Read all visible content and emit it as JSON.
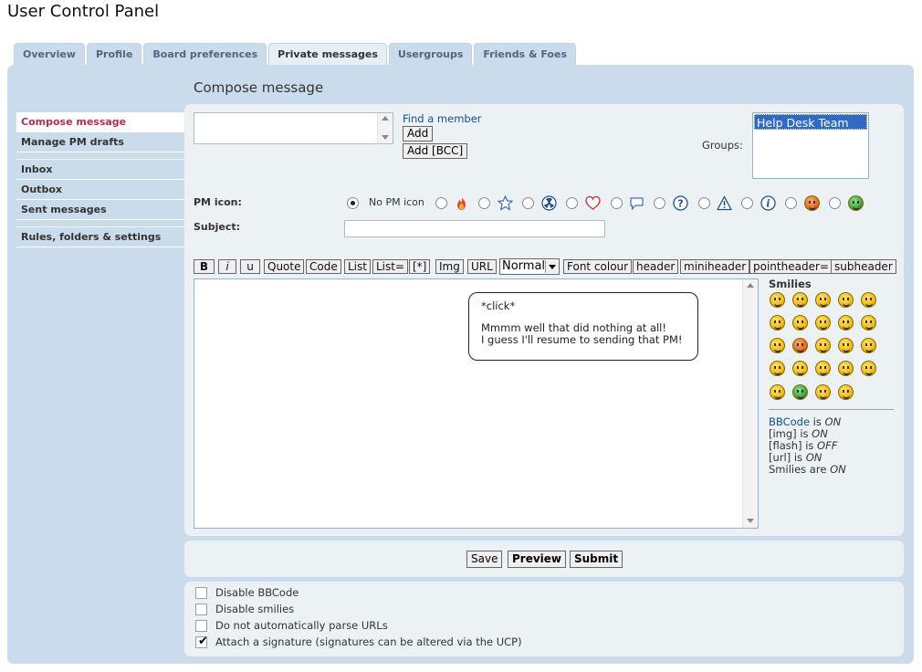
{
  "page": {
    "title": "User Control Panel"
  },
  "tabs": [
    "Overview",
    "Profile",
    "Board preferences",
    "Private messages",
    "Usergroups",
    "Friends & Foes"
  ],
  "compose": {
    "title": "Compose message"
  },
  "sidebar": {
    "group1": [
      "Compose message",
      "Manage PM drafts"
    ],
    "group2": [
      "Inbox",
      "Outbox",
      "Sent messages"
    ],
    "group3": [
      "Rules, folders & settings"
    ]
  },
  "recipients": {
    "find_member": "Find a member",
    "add_label": "Add",
    "add_bcc_label": "Add [BCC]",
    "groups_label": "Groups:",
    "groups_options": [
      "Help Desk Team"
    ]
  },
  "pm_icon": {
    "label": "PM icon:",
    "no_icon_label": "No PM icon",
    "icons": [
      "fire-icon",
      "star-icon",
      "radioactive-icon",
      "heart-icon",
      "speech-bubble-icon",
      "question-icon",
      "warning-icon",
      "info-icon",
      "sad-face-icon",
      "grin-icon"
    ]
  },
  "subject": {
    "label": "Subject:",
    "value": ""
  },
  "toolbar": {
    "buttons": [
      "B",
      "i",
      "u",
      "Quote",
      "Code",
      "List",
      "List=",
      "[*]",
      "Img",
      "URL"
    ],
    "font_size": "Normal",
    "buttons2": [
      "Font colour",
      "header",
      "miniheader",
      "pointheader=",
      "subheader"
    ]
  },
  "message": {
    "bubble_line1": "*click*",
    "bubble_line2": "Mmmm well that did nothing at all!",
    "bubble_line3": "I guess I'll resume to sending that PM!"
  },
  "smilies": {
    "title": "Smilies"
  },
  "bbcode_status": {
    "bbcode_link": "BBCode",
    "bbcode": " is ",
    "bbcode_val": "ON",
    "img": "[img] is ",
    "img_val": "ON",
    "flash": "[flash] is ",
    "flash_val": "OFF",
    "url": "[url] is ",
    "url_val": "ON",
    "smilies": "Smilies are ",
    "smilies_val": "ON"
  },
  "actions": {
    "save": "Save",
    "preview": "Preview",
    "submit": "Submit"
  },
  "options": {
    "disable_bbcode": {
      "label": "Disable BBCode",
      "checked": false
    },
    "disable_smilies": {
      "label": "Disable smilies",
      "checked": false
    },
    "no_parse_urls": {
      "label": "Do not automatically parse URLs",
      "checked": false
    },
    "attach_signature": {
      "label": "Attach a signature (signatures can be altered via the UCP)",
      "checked": true
    }
  }
}
